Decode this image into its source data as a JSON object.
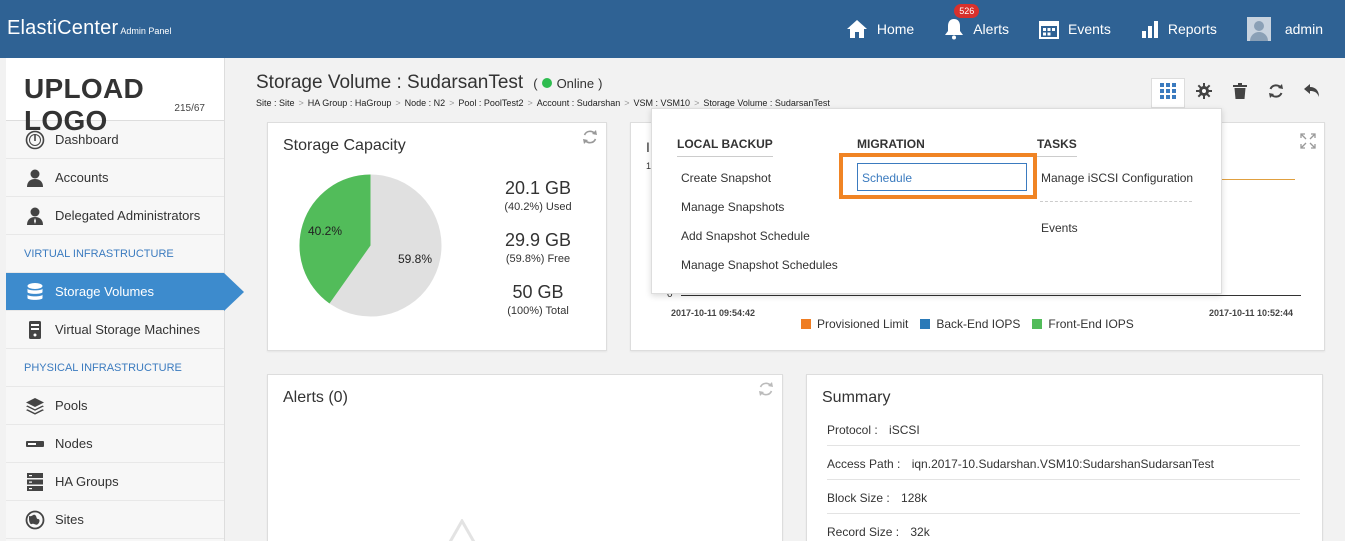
{
  "app": {
    "name": "ElastiCenter",
    "subtitle": "Admin Panel"
  },
  "topnav": {
    "home": "Home",
    "alerts": "Alerts",
    "alerts_count": "526",
    "events": "Events",
    "reports": "Reports",
    "user": "admin"
  },
  "sidebar": {
    "logo": "UPLOAD LOGO",
    "logo_dim": "215/67",
    "items_top": [
      {
        "label": "Dashboard",
        "icon": "dashboard-icon"
      },
      {
        "label": "Accounts",
        "icon": "user-icon"
      },
      {
        "label": "Delegated Administrators",
        "icon": "admin-user-icon"
      }
    ],
    "section_virtual": "VIRTUAL INFRASTRUCTURE",
    "items_virtual": [
      {
        "label": "Storage Volumes",
        "icon": "database-icon",
        "active": true
      },
      {
        "label": "Virtual Storage Machines",
        "icon": "vsm-icon"
      }
    ],
    "section_physical": "PHYSICAL INFRASTRUCTURE",
    "items_physical": [
      {
        "label": "Pools",
        "icon": "layers-icon"
      },
      {
        "label": "Nodes",
        "icon": "server-icon"
      },
      {
        "label": "HA Groups",
        "icon": "ha-group-icon"
      },
      {
        "label": "Sites",
        "icon": "globe-icon"
      }
    ]
  },
  "page": {
    "title": "Storage Volume : SudarsanTest",
    "status_open": "(",
    "status": "Online",
    "status_close": ")",
    "status_color": "#2ebc4f",
    "breadcrumb": [
      "Site : Site",
      "HA Group : HaGroup",
      "Node : N2",
      "Pool : PoolTest2",
      "Account : Sudarshan",
      "VSM : VSM10",
      "Storage Volume : SudarsanTest"
    ]
  },
  "capacity": {
    "title": "Storage Capacity",
    "used_pct_label": "40.2%",
    "free_pct_label": "59.8%",
    "used_value": "20.1 GB",
    "used_sub": "(40.2%) Used",
    "free_value": "29.9 GB",
    "free_sub": "(59.8%) Free",
    "total_value": "50 GB",
    "total_sub": "(100%) Total",
    "used_color": "#52bc5a",
    "free_color": "#e0e0e0"
  },
  "chart_data": {
    "type": "line",
    "x": [
      "2017-10-11 09:54:42",
      "2017-10-11 10:52:44"
    ],
    "y_tick_visible": "0",
    "series": [
      {
        "name": "Provisioned Limit",
        "color": "#ef7d22"
      },
      {
        "name": "Back-End IOPS",
        "color": "#2a7ab8"
      },
      {
        "name": "Front-End IOPS",
        "color": "#52bc5a"
      }
    ],
    "legend": "bottom"
  },
  "alerts": {
    "title": "Alerts (0)"
  },
  "summary": {
    "title": "Summary",
    "rows": [
      {
        "key": "Protocol :",
        "value": "iSCSI"
      },
      {
        "key": "Access Path :",
        "value": "iqn.2017-10.Sudarshan.VSM10:SudarshanSudarsanTest"
      },
      {
        "key": "Block Size :",
        "value": "128k"
      },
      {
        "key": "Record Size :",
        "value": "32k"
      }
    ]
  },
  "dropdown": {
    "local_backup": {
      "header": "LOCAL BACKUP",
      "items": [
        "Create Snapshot",
        "Manage Snapshots",
        "Add Snapshot Schedule",
        "Manage Snapshot Schedules"
      ]
    },
    "migration": {
      "header": "MIGRATION",
      "items": [
        "Schedule"
      ]
    },
    "tasks": {
      "header": "TASKS",
      "items": [
        "Manage iSCSI Configuration",
        "Events"
      ]
    },
    "highlight_color": "#f08424"
  }
}
